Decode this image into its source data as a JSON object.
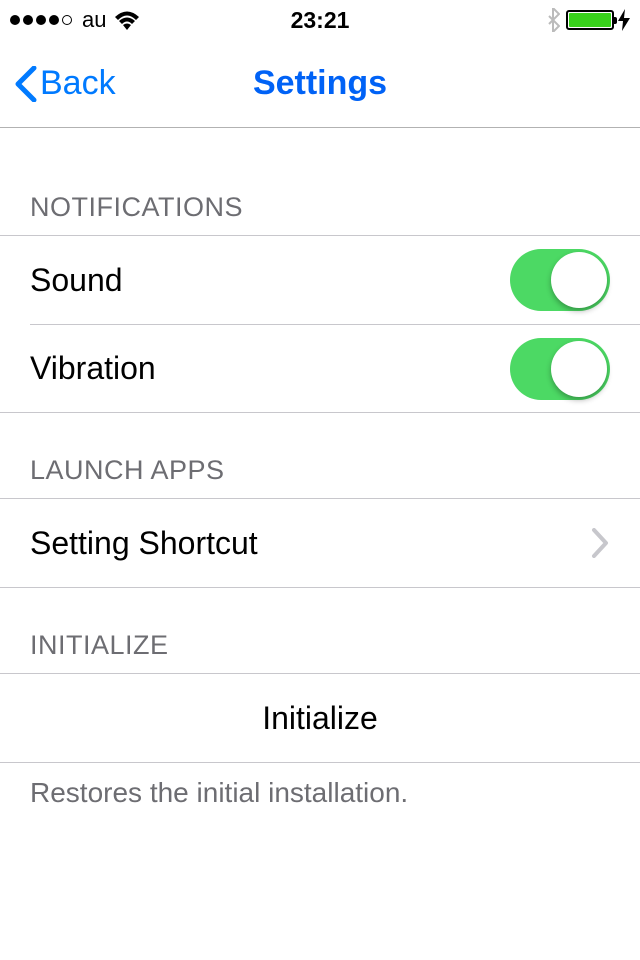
{
  "status": {
    "carrier": "au",
    "time": "23:21"
  },
  "nav": {
    "back_label": "Back",
    "title": "Settings"
  },
  "sections": {
    "notifications": {
      "header": "NOTIFICATIONS",
      "sound_label": "Sound",
      "sound_on": true,
      "vibration_label": "Vibration",
      "vibration_on": true
    },
    "launch_apps": {
      "header": "LAUNCH APPS",
      "setting_shortcut_label": "Setting Shortcut"
    },
    "initialize": {
      "header": "INITIALIZE",
      "initialize_label": "Initialize",
      "footer": "Restores the initial installation."
    }
  }
}
